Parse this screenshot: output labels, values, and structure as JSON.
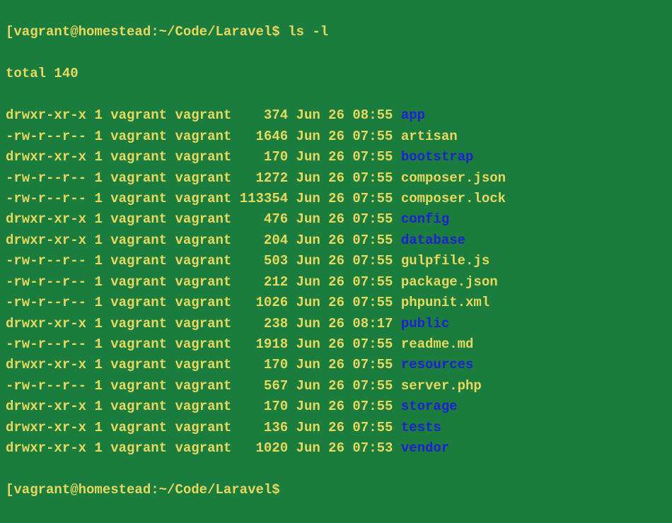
{
  "prompt": {
    "open_bracket": "[",
    "user_host": "vagrant@homestead",
    "separator": ":",
    "path": "~/Code/Laravel",
    "close_dollar": "$",
    "command": "ls -l"
  },
  "total_line": "total 140",
  "rows": [
    {
      "perm": "drwxr-xr-x",
      "links": "1",
      "owner": "vagrant",
      "group": "vagrant",
      "size": "374",
      "month": "Jun",
      "day": "26",
      "time": "08:55",
      "name": "app",
      "is_dir": true
    },
    {
      "perm": "-rw-r--r--",
      "links": "1",
      "owner": "vagrant",
      "group": "vagrant",
      "size": "1646",
      "month": "Jun",
      "day": "26",
      "time": "07:55",
      "name": "artisan",
      "is_dir": false
    },
    {
      "perm": "drwxr-xr-x",
      "links": "1",
      "owner": "vagrant",
      "group": "vagrant",
      "size": "170",
      "month": "Jun",
      "day": "26",
      "time": "07:55",
      "name": "bootstrap",
      "is_dir": true
    },
    {
      "perm": "-rw-r--r--",
      "links": "1",
      "owner": "vagrant",
      "group": "vagrant",
      "size": "1272",
      "month": "Jun",
      "day": "26",
      "time": "07:55",
      "name": "composer.json",
      "is_dir": false
    },
    {
      "perm": "-rw-r--r--",
      "links": "1",
      "owner": "vagrant",
      "group": "vagrant",
      "size": "113354",
      "month": "Jun",
      "day": "26",
      "time": "07:55",
      "name": "composer.lock",
      "is_dir": false
    },
    {
      "perm": "drwxr-xr-x",
      "links": "1",
      "owner": "vagrant",
      "group": "vagrant",
      "size": "476",
      "month": "Jun",
      "day": "26",
      "time": "07:55",
      "name": "config",
      "is_dir": true
    },
    {
      "perm": "drwxr-xr-x",
      "links": "1",
      "owner": "vagrant",
      "group": "vagrant",
      "size": "204",
      "month": "Jun",
      "day": "26",
      "time": "07:55",
      "name": "database",
      "is_dir": true
    },
    {
      "perm": "-rw-r--r--",
      "links": "1",
      "owner": "vagrant",
      "group": "vagrant",
      "size": "503",
      "month": "Jun",
      "day": "26",
      "time": "07:55",
      "name": "gulpfile.js",
      "is_dir": false
    },
    {
      "perm": "-rw-r--r--",
      "links": "1",
      "owner": "vagrant",
      "group": "vagrant",
      "size": "212",
      "month": "Jun",
      "day": "26",
      "time": "07:55",
      "name": "package.json",
      "is_dir": false
    },
    {
      "perm": "-rw-r--r--",
      "links": "1",
      "owner": "vagrant",
      "group": "vagrant",
      "size": "1026",
      "month": "Jun",
      "day": "26",
      "time": "07:55",
      "name": "phpunit.xml",
      "is_dir": false
    },
    {
      "perm": "drwxr-xr-x",
      "links": "1",
      "owner": "vagrant",
      "group": "vagrant",
      "size": "238",
      "month": "Jun",
      "day": "26",
      "time": "08:17",
      "name": "public",
      "is_dir": true
    },
    {
      "perm": "-rw-r--r--",
      "links": "1",
      "owner": "vagrant",
      "group": "vagrant",
      "size": "1918",
      "month": "Jun",
      "day": "26",
      "time": "07:55",
      "name": "readme.md",
      "is_dir": false
    },
    {
      "perm": "drwxr-xr-x",
      "links": "1",
      "owner": "vagrant",
      "group": "vagrant",
      "size": "170",
      "month": "Jun",
      "day": "26",
      "time": "07:55",
      "name": "resources",
      "is_dir": true
    },
    {
      "perm": "-rw-r--r--",
      "links": "1",
      "owner": "vagrant",
      "group": "vagrant",
      "size": "567",
      "month": "Jun",
      "day": "26",
      "time": "07:55",
      "name": "server.php",
      "is_dir": false
    },
    {
      "perm": "drwxr-xr-x",
      "links": "1",
      "owner": "vagrant",
      "group": "vagrant",
      "size": "170",
      "month": "Jun",
      "day": "26",
      "time": "07:55",
      "name": "storage",
      "is_dir": true
    },
    {
      "perm": "drwxr-xr-x",
      "links": "1",
      "owner": "vagrant",
      "group": "vagrant",
      "size": "136",
      "month": "Jun",
      "day": "26",
      "time": "07:55",
      "name": "tests",
      "is_dir": true
    },
    {
      "perm": "drwxr-xr-x",
      "links": "1",
      "owner": "vagrant",
      "group": "vagrant",
      "size": "1020",
      "month": "Jun",
      "day": "26",
      "time": "07:53",
      "name": "vendor",
      "is_dir": true
    }
  ],
  "prompt2": {
    "open_bracket": "[",
    "user_host": "vagrant@homestead",
    "separator": ":",
    "path": "~/Code/Laravel",
    "close_dollar": "$"
  }
}
